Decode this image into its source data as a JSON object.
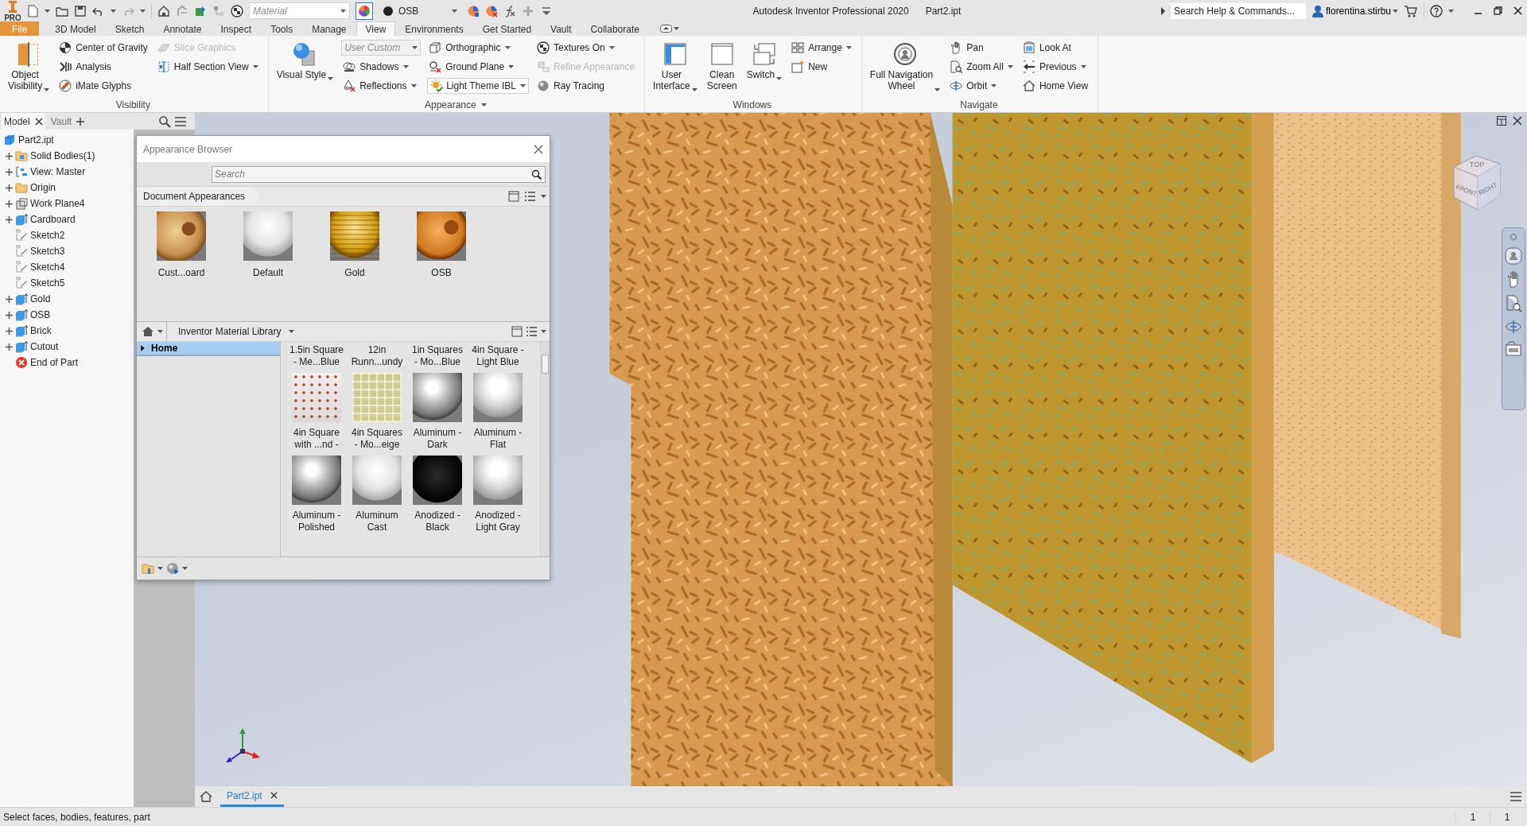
{
  "title_bar": {
    "logo_badge": "PRO",
    "material": {
      "placeholder": "Material"
    },
    "appearance": {
      "value": "OSB"
    },
    "title": "Autodesk Inventor Professional 2020",
    "document": "Part2.ipt",
    "search": {
      "placeholder": "Search Help & Commands..."
    },
    "user": "florentina.stirbu"
  },
  "ribbon_tabs": [
    {
      "label": "File",
      "kind": "file",
      "selected": false
    },
    {
      "label": "3D Model",
      "kind": "tab",
      "selected": false
    },
    {
      "label": "Sketch",
      "kind": "tab",
      "selected": false
    },
    {
      "label": "Annotate",
      "kind": "tab",
      "selected": false
    },
    {
      "label": "Inspect",
      "kind": "tab",
      "selected": false
    },
    {
      "label": "Tools",
      "kind": "tab",
      "selected": false
    },
    {
      "label": "Manage",
      "kind": "tab",
      "selected": false
    },
    {
      "label": "View",
      "kind": "tab",
      "selected": true
    },
    {
      "label": "Environments",
      "kind": "tab",
      "selected": false
    },
    {
      "label": "Get Started",
      "kind": "tab",
      "selected": false
    },
    {
      "label": "Vault",
      "kind": "tab",
      "selected": false
    },
    {
      "label": "Collaborate",
      "kind": "tab",
      "selected": false
    }
  ],
  "ribbon_panels": [
    {
      "title": "Visibility",
      "title_dropdown": false,
      "columns": [
        [
          {
            "kind": "large",
            "label": "Object\nVisibility",
            "dropdown": true,
            "disabled": false
          }
        ],
        [
          {
            "kind": "small",
            "label": "Center of Gravity",
            "dropdown": false,
            "disabled": false
          },
          {
            "kind": "small",
            "label": "Analysis",
            "dropdown": false,
            "disabled": false
          },
          {
            "kind": "small",
            "label": "iMate Glyphs",
            "dropdown": false,
            "disabled": false
          }
        ],
        [
          {
            "kind": "small",
            "label": "Slice Graphics",
            "dropdown": false,
            "disabled": true
          },
          {
            "kind": "small",
            "label": "Half Section View",
            "dropdown": true,
            "disabled": false
          }
        ]
      ]
    },
    {
      "title": "Appearance",
      "title_dropdown": true,
      "columns": [
        [
          {
            "kind": "large",
            "label": "Visual Style",
            "dropdown": true,
            "disabled": false
          }
        ],
        [
          {
            "kind": "combo",
            "label": "User Custom",
            "dropdown": true,
            "disabled": true
          },
          {
            "kind": "small",
            "label": "Shadows",
            "dropdown": true,
            "disabled": false
          },
          {
            "kind": "small",
            "label": "Reflections",
            "dropdown": true,
            "disabled": false
          }
        ],
        [
          {
            "kind": "small",
            "label": "Orthographic",
            "dropdown": true,
            "disabled": false
          },
          {
            "kind": "small",
            "label": "Ground Plane",
            "dropdown": true,
            "disabled": false
          },
          {
            "kind": "combo",
            "label": "Light Theme IBL",
            "dropdown": true,
            "disabled": false
          }
        ],
        [
          {
            "kind": "small",
            "label": "Textures On",
            "dropdown": true,
            "disabled": false
          },
          {
            "kind": "small",
            "label": "Refine Appearance",
            "dropdown": false,
            "disabled": true
          },
          {
            "kind": "small",
            "label": "Ray Tracing",
            "dropdown": false,
            "disabled": false
          }
        ]
      ]
    },
    {
      "title": "Windows",
      "title_dropdown": false,
      "columns": [
        [
          {
            "kind": "large",
            "label": "User\nInterface",
            "dropdown": true,
            "disabled": false
          }
        ],
        [
          {
            "kind": "large",
            "label": "Clean\nScreen",
            "dropdown": false,
            "disabled": false
          }
        ],
        [
          {
            "kind": "large",
            "label": "Switch",
            "dropdown": true,
            "disabled": false
          }
        ],
        [
          {
            "kind": "small",
            "label": "Arrange",
            "dropdown": true,
            "disabled": false
          },
          {
            "kind": "small",
            "label": "New",
            "dropdown": false,
            "disabled": false
          }
        ]
      ]
    },
    {
      "title": "Navigate",
      "title_dropdown": false,
      "columns": [
        [
          {
            "kind": "large",
            "label": "Full Navigation\nWheel",
            "dropdown": true,
            "disabled": false
          }
        ],
        [
          {
            "kind": "small",
            "label": "Pan",
            "dropdown": false,
            "disabled": false
          },
          {
            "kind": "small",
            "label": "Zoom All",
            "dropdown": true,
            "disabled": false
          },
          {
            "kind": "small",
            "label": "Orbit",
            "dropdown": true,
            "disabled": false
          }
        ],
        [
          {
            "kind": "small",
            "label": "Look At",
            "dropdown": false,
            "disabled": false
          },
          {
            "kind": "small",
            "label": "Previous",
            "dropdown": true,
            "disabled": false
          },
          {
            "kind": "small",
            "label": "Home View",
            "dropdown": false,
            "disabled": false
          }
        ]
      ]
    }
  ],
  "model_browser": {
    "tabs": [
      {
        "label": "Model",
        "selected": true
      },
      {
        "label": "Vault",
        "selected": false
      }
    ],
    "tree": [
      {
        "label": "Part2.ipt",
        "kind": "part",
        "children": [
          {
            "label": "Solid Bodies(1)",
            "kind": "bodies",
            "expanded": false
          },
          {
            "label": "View: Master",
            "kind": "view",
            "expanded": false
          },
          {
            "label": "Origin",
            "kind": "folder",
            "expanded": false
          },
          {
            "label": "Work Plane4",
            "kind": "workplane",
            "expanded": false
          },
          {
            "label": "Cardboard",
            "kind": "feature",
            "expanded": false
          },
          {
            "label": "Sketch2",
            "kind": "sketch"
          },
          {
            "label": "Sketch3",
            "kind": "sketch"
          },
          {
            "label": "Sketch4",
            "kind": "sketch"
          },
          {
            "label": "Sketch5",
            "kind": "sketch"
          },
          {
            "label": "Gold",
            "kind": "feature",
            "expanded": false
          },
          {
            "label": "OSB",
            "kind": "feature",
            "expanded": false
          },
          {
            "label": "Brick",
            "kind": "feature",
            "expanded": false
          },
          {
            "label": "Cutout",
            "kind": "feature",
            "expanded": false
          },
          {
            "label": "End of Part",
            "kind": "end"
          }
        ]
      }
    ]
  },
  "appearance_browser": {
    "title": "Appearance Browser",
    "search": {
      "placeholder": "Search"
    },
    "document_appearances": {
      "label": "Document Appearances",
      "items": [
        {
          "name": "Cust...oard",
          "kind": "cardboard"
        },
        {
          "name": "Default",
          "kind": "plain"
        },
        {
          "name": "Gold",
          "kind": "gold"
        },
        {
          "name": "OSB",
          "kind": "osb"
        }
      ]
    },
    "library": {
      "label": "Inventor Material Library",
      "tree": [
        {
          "label": "Home",
          "selected": true,
          "expanded": false
        }
      ],
      "items": [
        {
          "name": "1.5in Square\n- Me...Blue",
          "kind": "scrolled"
        },
        {
          "name": "12in\nRunn...undy",
          "kind": "scrolled"
        },
        {
          "name": "1in Squares\n- Mo...Blue",
          "kind": "scrolled"
        },
        {
          "name": "4in Square -\nLight Blue",
          "kind": "scrolled"
        },
        {
          "name": "4in Square\nwith ...nd -",
          "kind": "tile"
        },
        {
          "name": "4in Squares\n- Mo...eige",
          "kind": "beige"
        },
        {
          "name": "Aluminum -\nDark",
          "kind": "chrome"
        },
        {
          "name": "Aluminum -\nFlat",
          "kind": "satin"
        },
        {
          "name": "Aluminum -\nPolished",
          "kind": "chrome"
        },
        {
          "name": "Aluminum\nCast",
          "kind": "plain"
        },
        {
          "name": "Anodized -\nBlack",
          "kind": "black"
        },
        {
          "name": "Anodized -\nLight Gray",
          "kind": "satin"
        }
      ]
    }
  },
  "viewport": {
    "view_cube": {
      "faces": [
        "TOP",
        "FRONT",
        "RIGHT"
      ]
    }
  },
  "document_tabs": [
    {
      "label": "Part2.ipt",
      "selected": true
    }
  ],
  "status_bar": {
    "prompt": "Select faces, bodies, features, part",
    "counters": [
      "1",
      "1"
    ]
  }
}
